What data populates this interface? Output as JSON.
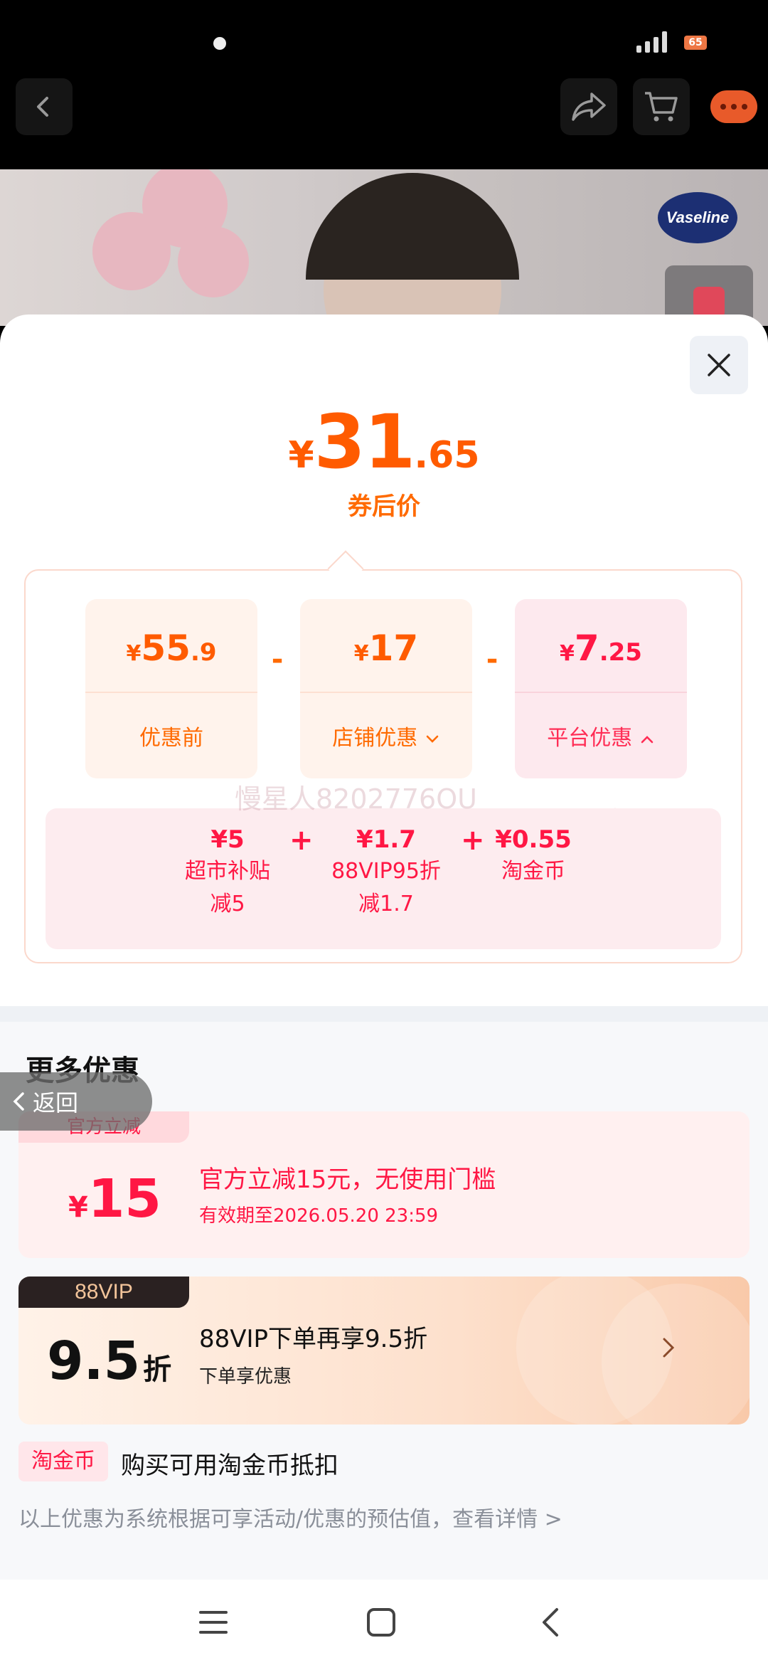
{
  "status_bar": {
    "battery_level": "65"
  },
  "nav": {
    "back_icon": "back-arrow-icon",
    "share_icon": "share-icon",
    "cart_icon": "cart-icon",
    "chat_icon": "chat-icon"
  },
  "hero": {
    "brand_badge": "Vaseline"
  },
  "sheet": {
    "final_price": {
      "currency": "¥",
      "integer": "31",
      "decimal": ".65",
      "label": "券后价"
    },
    "breakdown": {
      "original": {
        "currency": "¥",
        "integer": "55",
        "decimal": ".9",
        "label": "优惠前"
      },
      "store": {
        "currency": "¥",
        "integer": "17",
        "decimal": "",
        "label": "店铺优惠"
      },
      "platform": {
        "currency": "¥",
        "integer": "7",
        "decimal": ".25",
        "label": "平台优惠"
      },
      "minus": "-",
      "platform_items": [
        {
          "amount": "¥5",
          "name_line1": "超市补贴",
          "name_line2": "减5"
        },
        {
          "amount": "¥1.7",
          "name_line1": "88VIP95折",
          "name_line2": "减1.7"
        },
        {
          "amount": "¥0.55",
          "name_line1": "淘金币",
          "name_line2": ""
        }
      ],
      "plus": "+"
    },
    "watermark": "慢星人8202776OU",
    "more_title": "更多优惠",
    "back_float_label": "返回",
    "coupon_official": {
      "tag": "官方立减",
      "currency": "¥",
      "amount": "15",
      "title": "官方立减15元，无使用门槛",
      "validity": "有效期至2026.05.20 23:59"
    },
    "coupon_vip": {
      "tag": "88VIP",
      "discount": "9.5",
      "unit": "折",
      "title": "88VIP下单再享9.5折",
      "subtitle": "下单享优惠"
    },
    "coin": {
      "tag": "淘金币",
      "text": "购买可用淘金币抵扣"
    },
    "footnote": "以上优惠为系统根据可享活动/优惠的预估值，查看详情 >"
  },
  "colors": {
    "accent_orange": "#ff5b00",
    "accent_red": "#ff1744"
  }
}
